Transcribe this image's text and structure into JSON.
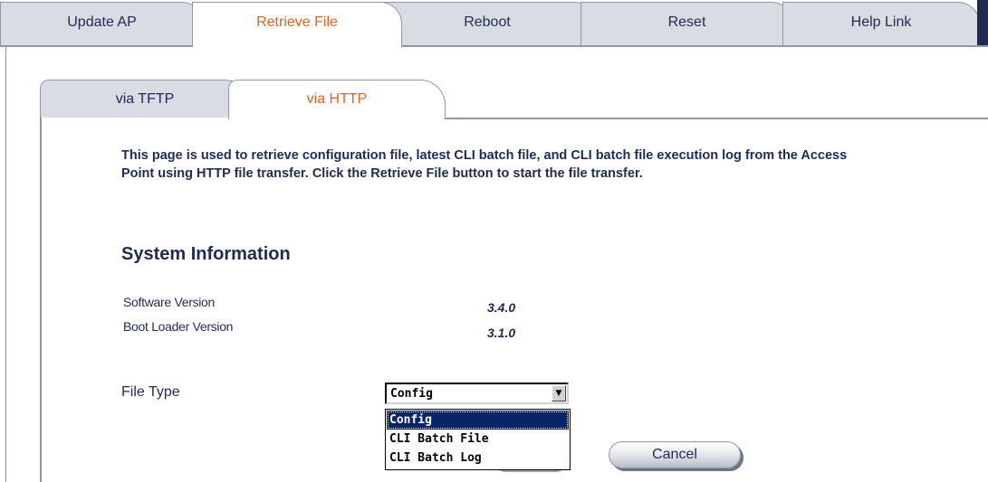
{
  "top_tabs": [
    {
      "label": "Update AP",
      "active": false
    },
    {
      "label": "Retrieve File",
      "active": true
    },
    {
      "label": "Reboot",
      "active": false
    },
    {
      "label": "Reset",
      "active": false
    },
    {
      "label": "Help Link",
      "active": false
    }
  ],
  "sub_tabs": [
    {
      "label": "via TFTP",
      "active": false
    },
    {
      "label": "via HTTP",
      "active": true
    }
  ],
  "description": "This page is used to retrieve configuration file, latest CLI batch file, and CLI batch file execution log from the Access Point using HTTP file transfer. Click the Retrieve File button to start the file transfer.",
  "system_info": {
    "title": "System Information",
    "rows": [
      {
        "label": "Software Version",
        "value": "3.4.0"
      },
      {
        "label": "Boot Loader Version",
        "value": "3.1.0"
      }
    ]
  },
  "file_type": {
    "label": "File Type",
    "selected": "Config",
    "options": [
      "Config",
      "CLI Batch File",
      "CLI Batch Log"
    ],
    "highlighted_option": "Config"
  },
  "buttons": {
    "cancel_label": "Cancel"
  },
  "colors": {
    "active_tab_text": "#e0621b",
    "text": "#1f2a55",
    "tab_bg": "#d9dde3",
    "dropdown_highlight": "#0a246a"
  }
}
